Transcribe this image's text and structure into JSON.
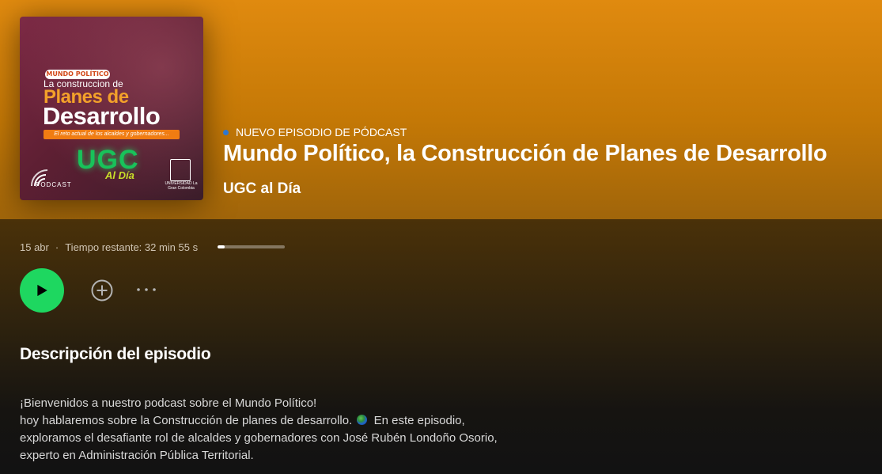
{
  "colors": {
    "header_bg": "#e08a0f",
    "accent_play": "#1ed760",
    "kind_dot": "#2e77d0",
    "background": "#121212"
  },
  "cover": {
    "tag": "MUNDO POLÍTICO",
    "line1": "La construccion de",
    "line2": "Planes de",
    "line3": "Desarrollo",
    "subtitle": "El reto actual de los alcaldes y gobernadores...",
    "brand": "UGC",
    "brand_sub": "Al Día",
    "podcast_label": "PODCAST",
    "university_label": "UNIVERSIDAD La Gran Colombia"
  },
  "episode": {
    "kind_label": "NUEVO EPISODIO DE PÓDCAST",
    "title": "Mundo Político, la Construcción de Planes de Desarrollo",
    "show": "UGC al Día",
    "date": "15 abr",
    "separator": "·",
    "remaining": "Tiempo restante: 32 min 55 s",
    "progress_fraction": 0.1
  },
  "controls": {
    "play_icon": "play-icon",
    "add_icon": "plus-circle-icon",
    "more_icon": "more-horizontal-icon"
  },
  "description": {
    "heading": "Descripción del episodio",
    "line1": "¡Bienvenidos a nuestro podcast sobre el Mundo Político!",
    "line2a": "hoy hablaremos sobre la Construcción de planes de desarrollo.",
    "line2b": "En este episodio,",
    "line3": "exploramos el desafiante rol de alcaldes y gobernadores con José Rubén Londoño Osorio,",
    "line4": "experto en Administración Pública Territorial."
  }
}
